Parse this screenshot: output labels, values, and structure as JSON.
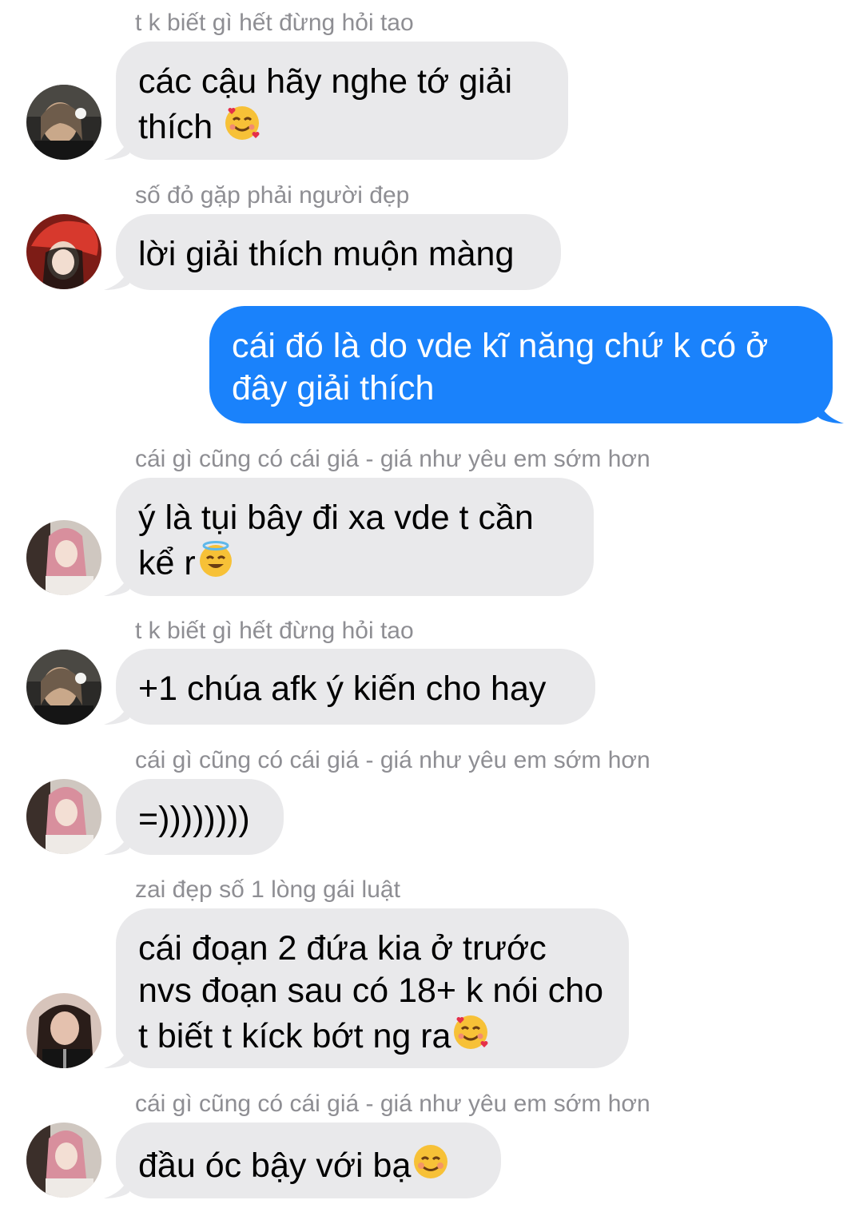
{
  "messages": [
    {
      "sender": "t k biết gì hết đừng hỏi tao",
      "text": "các cậu hãy nghe tớ giải thích",
      "emoji": "smiling-face-with-hearts"
    },
    {
      "sender": "số đỏ gặp phải người đẹp",
      "text": "lời giải thích muộn màng"
    },
    {
      "text": "cái đó là do vde kĩ năng chứ k có ở đây giải thích"
    },
    {
      "sender": "cái gì cũng có cái giá - giá như yêu em sớm hơn",
      "text": "ý là tụi bây đi xa vde t cần kể r",
      "emoji": "smiling-face-with-halo"
    },
    {
      "sender": "t k biết gì hết đừng hỏi tao",
      "text": "+1 chúa afk ý kiến cho hay"
    },
    {
      "sender": "cái gì cũng có cái giá - giá như yêu em sớm hơn",
      "text": "=))))))))"
    },
    {
      "sender": "zai đẹp số 1 lòng gái luật",
      "text": "cái đoạn 2 đứa kia ở trước nvs đoạn sau có 18+ k nói cho t biết t kíck bớt ng ra",
      "emoji": "smiling-face-with-hearts"
    },
    {
      "sender": "cái gì cũng có cái giá - giá như yêu em sớm hơn",
      "text": "đầu óc bậy với bạ",
      "emoji": "smiling-face"
    }
  ],
  "colors": {
    "incoming_bubble": "#e9e9eb",
    "outgoing_bubble": "#1a82fb",
    "sender_name": "#8e8e93"
  }
}
